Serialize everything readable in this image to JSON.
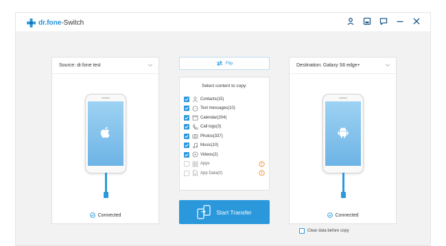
{
  "app": {
    "brand": "dr.fone",
    "module": "-Switch",
    "icons": [
      "user-icon",
      "save-icon",
      "feedback-icon",
      "minimize-icon",
      "close-icon"
    ]
  },
  "source": {
    "label": "Source: dr.fone test",
    "status": "Connected",
    "device_logo": "apple-icon"
  },
  "destination": {
    "label": "Destination: Galaxy S6 edge+",
    "status": "Connected",
    "device_logo": "android-icon",
    "clear_option": "Clear data before copy"
  },
  "flip": {
    "label": "Flip"
  },
  "content": {
    "title": "Select content to copy:",
    "items": [
      {
        "label": "Contacts(15)",
        "checked": true,
        "icon": "contacts-icon"
      },
      {
        "label": "Text messages(10)",
        "checked": true,
        "icon": "message-icon"
      },
      {
        "label": "Calendar(204)",
        "checked": true,
        "icon": "calendar-icon"
      },
      {
        "label": "Call logs(3)",
        "checked": true,
        "icon": "phone-icon"
      },
      {
        "label": "Photos(337)",
        "checked": true,
        "icon": "camera-icon"
      },
      {
        "label": "Music(10)",
        "checked": true,
        "icon": "music-icon"
      },
      {
        "label": "Videos(2)",
        "checked": true,
        "icon": "video-icon"
      },
      {
        "label": "Apps",
        "checked": false,
        "icon": "apps-icon",
        "warning": true
      },
      {
        "label": "App Data(0)",
        "checked": false,
        "icon": "app-data-icon",
        "warning": true
      }
    ]
  },
  "start": {
    "label": "Start Transfer"
  },
  "colors": {
    "accent": "#2a98db",
    "warning": "#f08a24"
  }
}
